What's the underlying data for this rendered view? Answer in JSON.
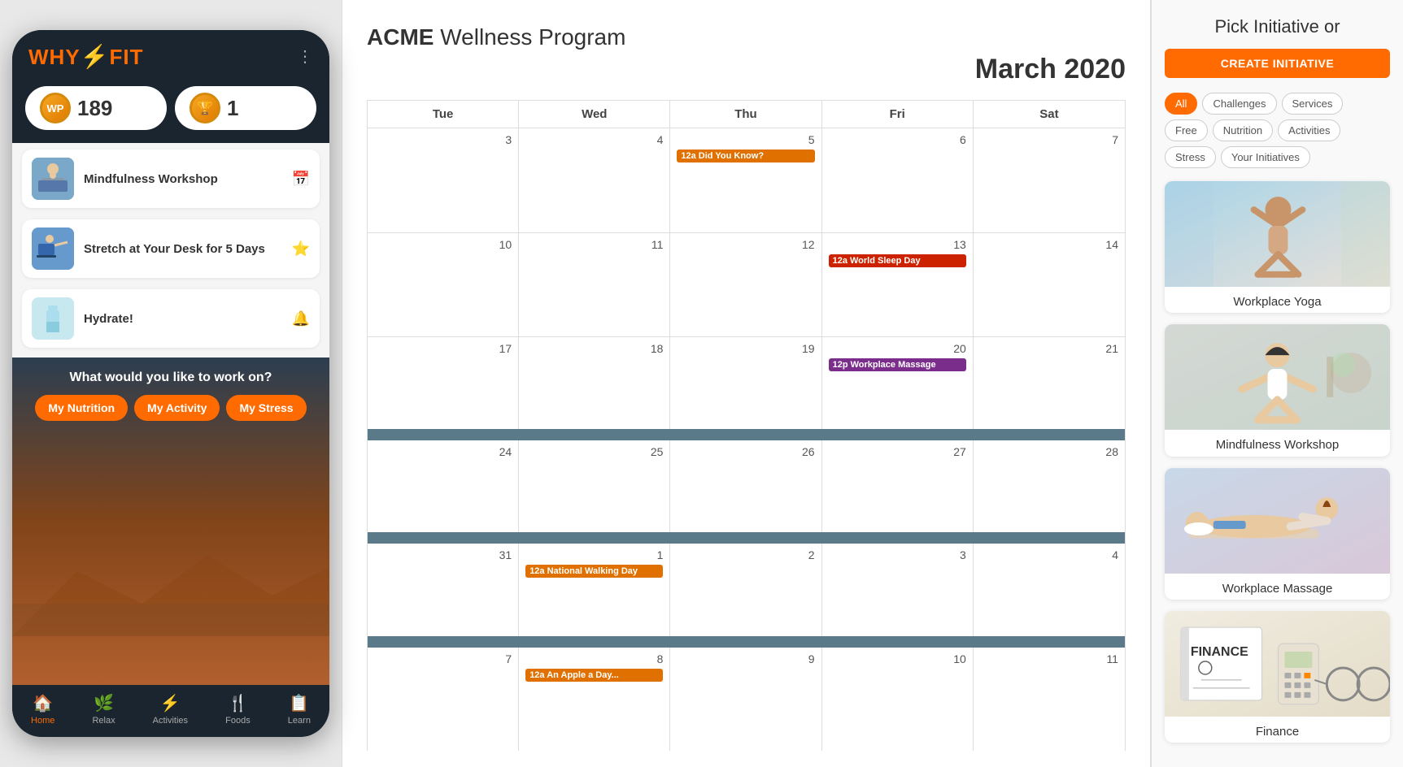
{
  "phone": {
    "logo": "WHY FIT",
    "logo_icon": "♣",
    "menu_dots": "⋮",
    "points": {
      "wp": {
        "label": "WP",
        "value": "189"
      },
      "trophy": {
        "label": "🏆",
        "value": "1"
      }
    },
    "activities": [
      {
        "id": "mindfulness",
        "title": "Mindfulness Workshop",
        "icon": "📅",
        "thumb_type": "mindful",
        "thumb_emoji": "👤"
      },
      {
        "id": "stretch",
        "title": "Stretch at Your Desk for 5 Days",
        "icon": "⭐",
        "thumb_type": "stretch",
        "thumb_emoji": "🖥️"
      },
      {
        "id": "hydrate",
        "title": "Hydrate!",
        "icon": "🔔",
        "thumb_type": "hydrate",
        "thumb_emoji": "💧"
      }
    ],
    "work_on": {
      "label": "What would you like to work on?",
      "buttons": [
        "My Nutrition",
        "My Activity",
        "My Stress"
      ]
    },
    "footer": [
      {
        "id": "home",
        "icon": "🏠",
        "label": "Home",
        "active": true
      },
      {
        "id": "relax",
        "icon": "🌿",
        "label": "Relax",
        "active": false
      },
      {
        "id": "activities",
        "icon": "⚡",
        "label": "Activities",
        "active": false
      },
      {
        "id": "foods",
        "icon": "🍴",
        "label": "Foods",
        "active": false
      },
      {
        "id": "learn",
        "icon": "📋",
        "label": "Learn",
        "active": false
      }
    ]
  },
  "calendar": {
    "program_name": "ACME",
    "program_suffix": " Wellness Program",
    "month_year": "March 2020",
    "headers": [
      "Tue",
      "Wed",
      "Thu",
      "Fri",
      "Sat"
    ],
    "weeks": [
      {
        "cells": [
          {
            "day": "3",
            "events": []
          },
          {
            "day": "4",
            "events": []
          },
          {
            "day": "5",
            "events": [
              {
                "label": "12a Did You Know?",
                "type": "orange"
              }
            ]
          },
          {
            "day": "6",
            "events": []
          },
          {
            "day": "7",
            "events": []
          }
        ],
        "has_divider": false
      },
      {
        "cells": [
          {
            "day": "10",
            "events": []
          },
          {
            "day": "11",
            "events": []
          },
          {
            "day": "12",
            "events": []
          },
          {
            "day": "13",
            "events": [
              {
                "label": "12a World Sleep Day",
                "type": "red"
              }
            ]
          },
          {
            "day": "14",
            "events": []
          }
        ],
        "has_divider": false
      },
      {
        "cells": [
          {
            "day": "17",
            "events": []
          },
          {
            "day": "18",
            "events": []
          },
          {
            "day": "19",
            "events": []
          },
          {
            "day": "20",
            "events": [
              {
                "label": "12p Workplace Massage",
                "type": "purple"
              }
            ]
          },
          {
            "day": "21",
            "events": []
          }
        ],
        "has_divider": true
      },
      {
        "cells": [
          {
            "day": "24",
            "events": []
          },
          {
            "day": "25",
            "events": []
          },
          {
            "day": "26",
            "events": []
          },
          {
            "day": "27",
            "events": []
          },
          {
            "day": "28",
            "events": []
          }
        ],
        "has_divider": true
      },
      {
        "cells": [
          {
            "day": "31",
            "events": []
          },
          {
            "day": "1",
            "events": [
              {
                "label": "12a National Walking Day",
                "type": "orange"
              }
            ]
          },
          {
            "day": "2",
            "events": []
          },
          {
            "day": "3",
            "events": []
          },
          {
            "day": "4",
            "events": []
          }
        ],
        "has_divider": true
      },
      {
        "cells": [
          {
            "day": "7",
            "events": []
          },
          {
            "day": "8",
            "events": [
              {
                "label": "12a An Apple a Day...",
                "type": "orange"
              }
            ]
          },
          {
            "day": "9",
            "events": []
          },
          {
            "day": "10",
            "events": []
          },
          {
            "day": "11",
            "events": []
          }
        ],
        "has_divider": false
      }
    ]
  },
  "initiatives": {
    "title": "Pick Initiative or",
    "create_label": "CREATE INITIATIVE",
    "filters": [
      {
        "label": "All",
        "active": true
      },
      {
        "label": "Challenges",
        "active": false
      },
      {
        "label": "Services",
        "active": false
      },
      {
        "label": "Free",
        "active": false
      },
      {
        "label": "Nutrition",
        "active": false
      },
      {
        "label": "Activities",
        "active": false
      },
      {
        "label": "Stress",
        "active": false
      },
      {
        "label": "Your Initiatives",
        "active": false
      }
    ],
    "cards": [
      {
        "title": "Workplace Yoga",
        "type": "yoga"
      },
      {
        "title": "Mindfulness Workshop",
        "type": "mindful"
      },
      {
        "title": "Workplace Massage",
        "type": "massage"
      },
      {
        "title": "Finance",
        "type": "finance"
      }
    ]
  }
}
